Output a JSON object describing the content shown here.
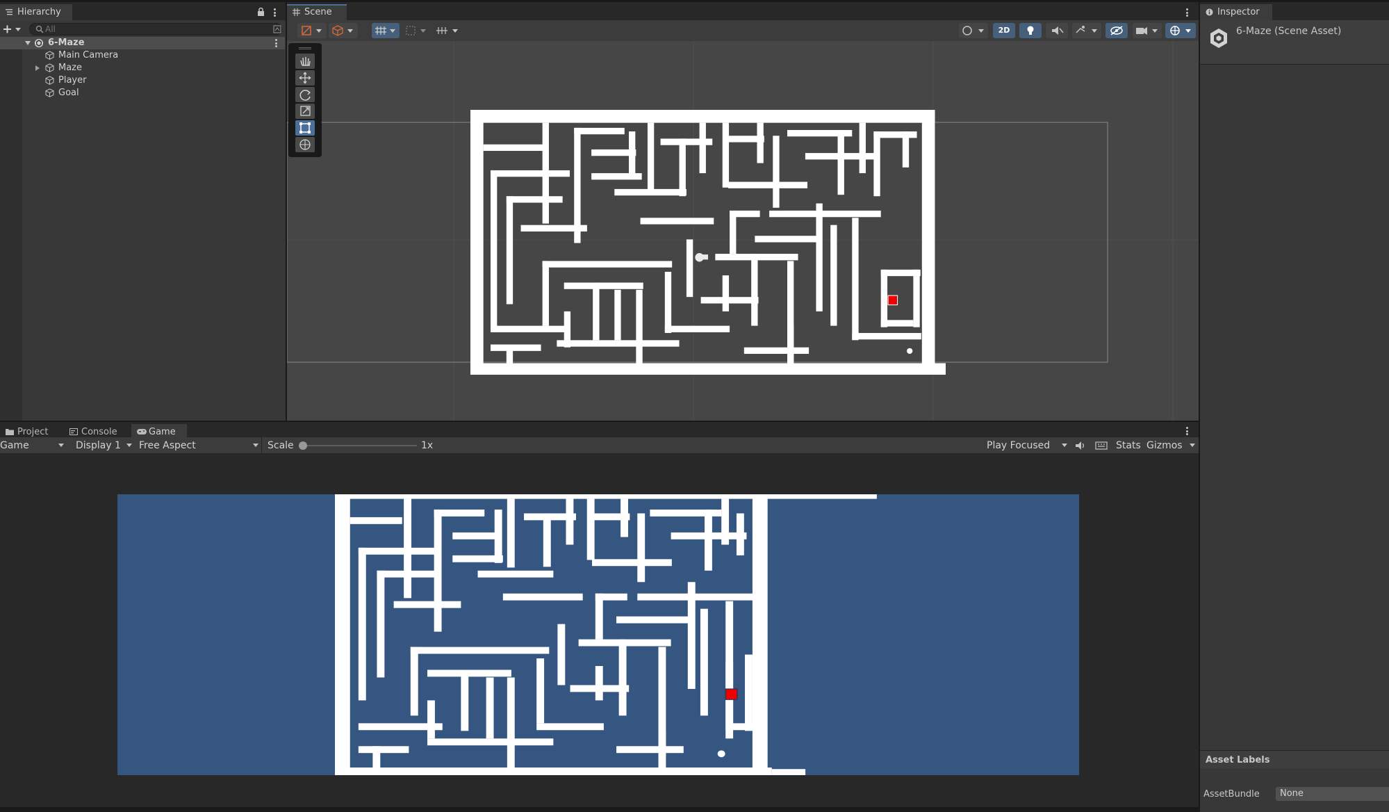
{
  "hierarchy": {
    "tab_label": "Hierarchy",
    "search_placeholder": "All",
    "scene_name": "6-Maze",
    "items": [
      {
        "label": "Main Camera",
        "expandable": false
      },
      {
        "label": "Maze",
        "expandable": true
      },
      {
        "label": "Player",
        "expandable": false
      },
      {
        "label": "Goal",
        "expandable": false
      }
    ]
  },
  "scene": {
    "tab_label": "Scene",
    "mode_2d_label": "2D",
    "tools": [
      "hand-tool",
      "move-tool",
      "rotate-tool",
      "scale-tool",
      "rect-tool",
      "transform-tool"
    ],
    "active_tool": "rect-tool"
  },
  "bottom_tabs": {
    "project": "Project",
    "console": "Console",
    "game": "Game"
  },
  "game_toolbar": {
    "view": "Game",
    "display": "Display 1",
    "aspect": "Free Aspect",
    "scale_label": "Scale",
    "scale_value": "1x",
    "scale_fraction": 0,
    "play_mode": "Play Focused",
    "stats": "Stats",
    "gizmos": "Gizmos"
  },
  "inspector": {
    "tab_label": "Inspector",
    "asset_title": "6-Maze (Scene Asset)",
    "asset_labels_heading": "Asset Labels",
    "assetbundle_label": "AssetBundle",
    "assetbundle_value": "None"
  },
  "colors": {
    "game_background": "#355681",
    "scene_background": "#464646",
    "maze_wall": "#ffffff",
    "goal": "#ee0000",
    "player": "#ffffff",
    "active_blue": "#4c6f99"
  }
}
